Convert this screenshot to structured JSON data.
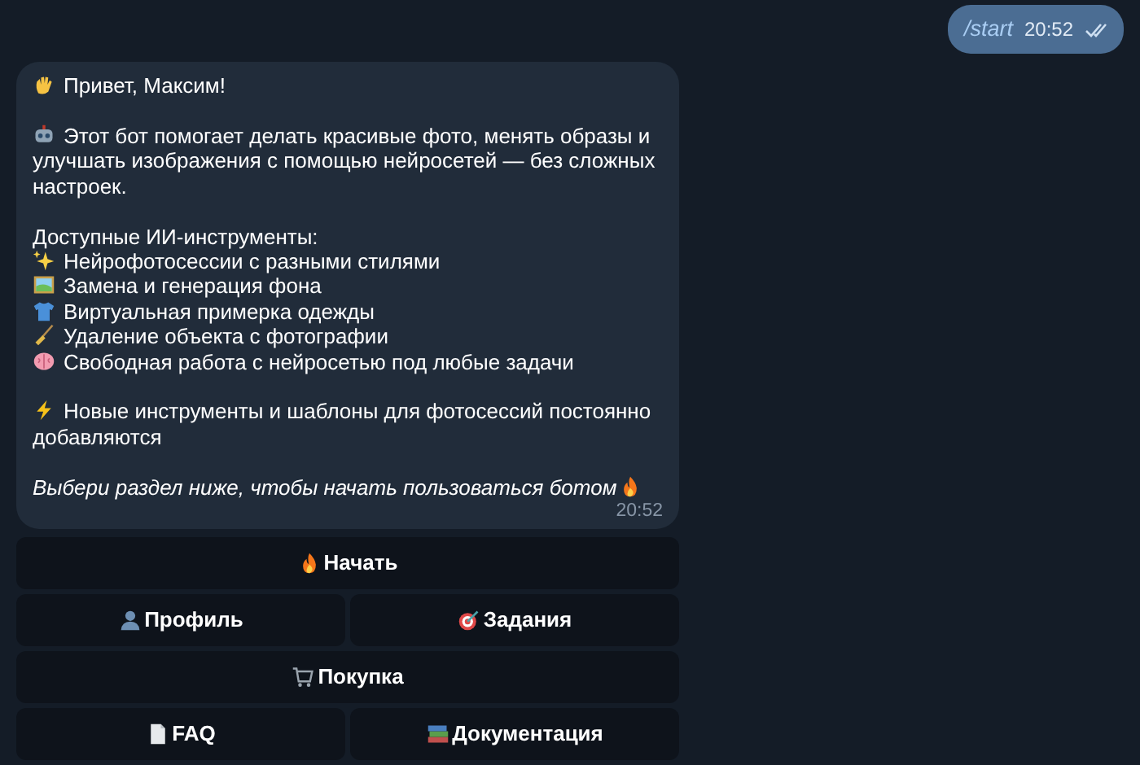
{
  "outgoing": {
    "text": "/start",
    "time": "20:52",
    "read": true
  },
  "message": {
    "greeting": "Привет, Максим!",
    "intro": "Этот бот помогает делать красивые фото, менять образы и улучшать изображения с помощью нейросетей — без сложных настроек.",
    "tools_heading": "Доступные ИИ-инструменты:",
    "tools": [
      "Нейрофотосессии с разными стилями",
      "Замена и генерация фона",
      "Виртуальная примерка одежды",
      "Удаление объекта с фотографии",
      "Свободная работа с нейросетью под любые задачи"
    ],
    "note": "Новые инструменты и шаблоны для фотосессий постоянно добавляются",
    "call_to_action": "Выбери раздел ниже, чтобы начать пользоваться ботом",
    "time": "20:52"
  },
  "keyboard": [
    [
      {
        "label": "Начать"
      }
    ],
    [
      {
        "label": "Профиль"
      },
      {
        "label": "Задания"
      }
    ],
    [
      {
        "label": "Покупка"
      }
    ],
    [
      {
        "label": "FAQ"
      },
      {
        "label": "Документация"
      }
    ]
  ]
}
